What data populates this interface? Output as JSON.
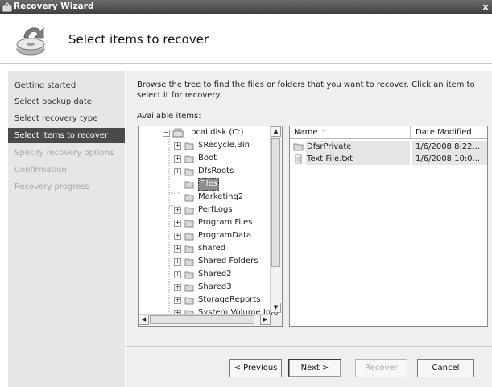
{
  "window": {
    "title": "Recovery Wizard",
    "close_glyph": "x",
    "icon": "recovery-wizard-icon"
  },
  "header": {
    "title": "Select items to recover",
    "icon": "backup-disk-icon"
  },
  "nav": {
    "items": [
      {
        "label": "Getting started",
        "state": "normal"
      },
      {
        "label": "Select backup date",
        "state": "normal"
      },
      {
        "label": "Select recovery type",
        "state": "normal"
      },
      {
        "label": "Select items to recover",
        "state": "active"
      },
      {
        "label": "Specify recovery options",
        "state": "disabled"
      },
      {
        "label": "Confirmation",
        "state": "disabled"
      },
      {
        "label": "Recovery progress",
        "state": "disabled"
      }
    ]
  },
  "main": {
    "instruction": "Browse the tree to find the files or folders that you want to recover. Click an item to select it for recovery.",
    "available_label": "Available items:",
    "tree": {
      "root": {
        "label": "Local disk (C:)",
        "icon": "drive-icon",
        "expanded": true
      },
      "children": [
        {
          "label": "$Recycle.Bin",
          "expandable": true,
          "selected": false
        },
        {
          "label": "Boot",
          "expandable": true,
          "selected": false
        },
        {
          "label": "DfsRoots",
          "expandable": true,
          "selected": false
        },
        {
          "label": "Files",
          "expandable": false,
          "selected": true
        },
        {
          "label": "Marketing2",
          "expandable": false,
          "selected": false
        },
        {
          "label": "PerfLogs",
          "expandable": true,
          "selected": false
        },
        {
          "label": "Program Files",
          "expandable": true,
          "selected": false
        },
        {
          "label": "ProgramData",
          "expandable": true,
          "selected": false
        },
        {
          "label": "shared",
          "expandable": true,
          "selected": false
        },
        {
          "label": "Shared Folders",
          "expandable": true,
          "selected": false
        },
        {
          "label": "Shared2",
          "expandable": true,
          "selected": false
        },
        {
          "label": "Shared3",
          "expandable": true,
          "selected": false
        },
        {
          "label": "StorageReports",
          "expandable": true,
          "selected": false
        },
        {
          "label": "System Volume Info",
          "expandable": true,
          "selected": false
        }
      ]
    },
    "list": {
      "columns": [
        "Name",
        "Date Modified"
      ],
      "sort_indicator": "^",
      "rows": [
        {
          "name": "DfsrPrivate",
          "date": "1/6/2008 8:22...",
          "icon": "folder-icon"
        },
        {
          "name": "Text File.txt",
          "date": "1/6/2008 10:0...",
          "icon": "text-file-icon"
        }
      ]
    }
  },
  "buttons": {
    "previous": "< Previous",
    "next": "Next >",
    "recover": "Recover",
    "cancel": "Cancel"
  },
  "colors": {
    "titlebar": "#4a4a4a",
    "nav_bg": "#e6e6e6",
    "nav_active": "#4a4a4a",
    "content_bg": "#efefef",
    "selection": "#8c8c8c"
  }
}
